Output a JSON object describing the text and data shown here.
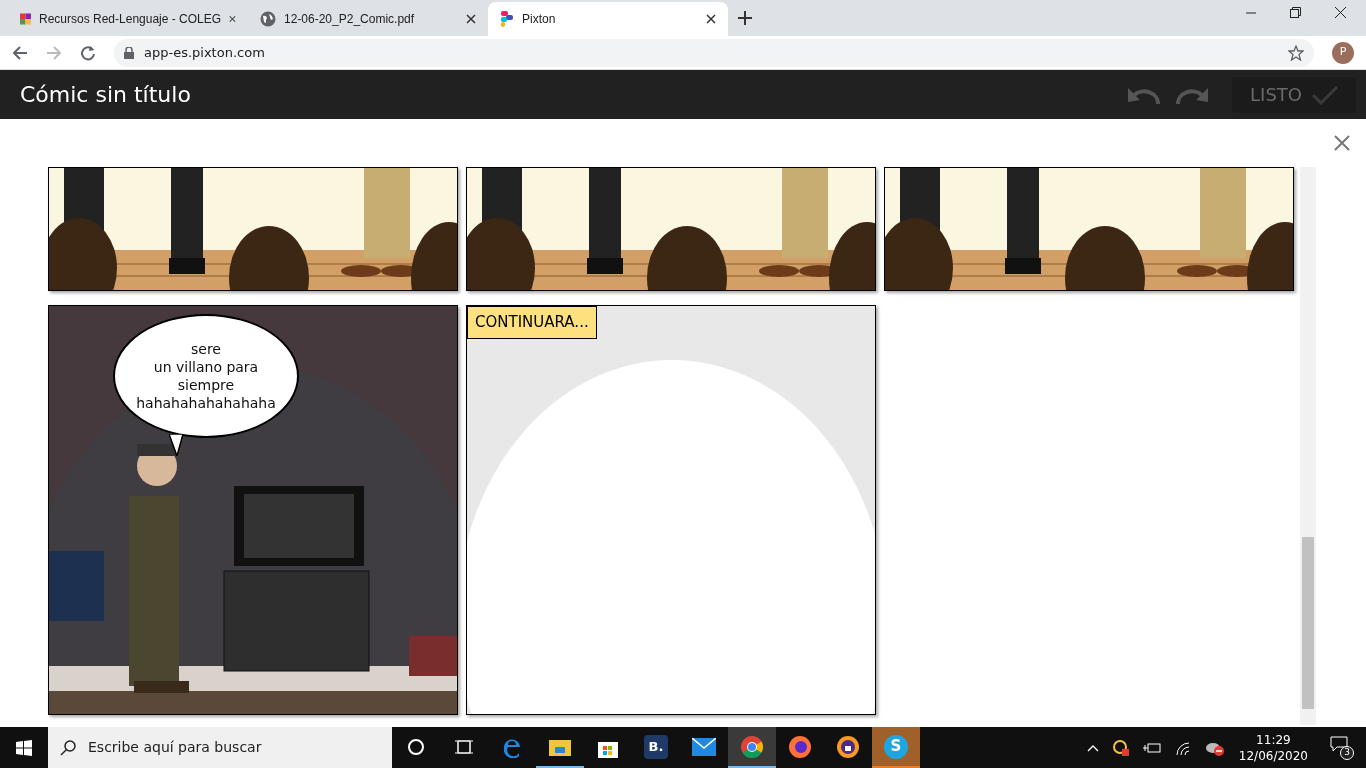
{
  "browser": {
    "tabs": [
      {
        "title": "Recursos Red-Lenguaje - COLEG",
        "selected": false
      },
      {
        "title": "12-06-20_P2_Comic.pdf",
        "selected": false
      },
      {
        "title": "Pixton",
        "selected": true
      }
    ],
    "address": "app-es.pixton.com",
    "profile": "P"
  },
  "app": {
    "title": "Cómic sin título",
    "done_button": {
      "label": "LISTO",
      "disabled": true
    }
  },
  "comic": {
    "panels": [
      {
        "kind": "floor"
      },
      {
        "kind": "floor"
      },
      {
        "kind": "floor"
      },
      {
        "kind": "room",
        "bubble_lines": [
          "sere",
          "un villano para",
          "siempre",
          "hahahahahahahaha"
        ]
      },
      {
        "kind": "blank",
        "caption": "CONTINUARA..."
      }
    ]
  },
  "taskbar": {
    "search_placeholder": "Escribe aquí para buscar",
    "apps": [
      {
        "open": false,
        "selected": false,
        "flashing": false
      },
      {
        "open": false,
        "selected": false,
        "flashing": false
      },
      {
        "open": false,
        "selected": false,
        "flashing": false
      },
      {
        "open": true,
        "selected": false,
        "flashing": false
      },
      {
        "open": false,
        "selected": false,
        "flashing": false
      },
      {
        "label": "B.",
        "open": false,
        "selected": false,
        "flashing": false
      },
      {
        "open": false,
        "selected": false,
        "flashing": false
      },
      {
        "open": true,
        "selected": true,
        "flashing": false
      },
      {
        "open": false,
        "selected": false,
        "flashing": false
      },
      {
        "open": false,
        "selected": false,
        "flashing": false
      },
      {
        "label": "S",
        "open": true,
        "selected": false,
        "flashing": true
      }
    ],
    "time": "11:29",
    "date": "12/06/2020",
    "notifications": "3"
  }
}
